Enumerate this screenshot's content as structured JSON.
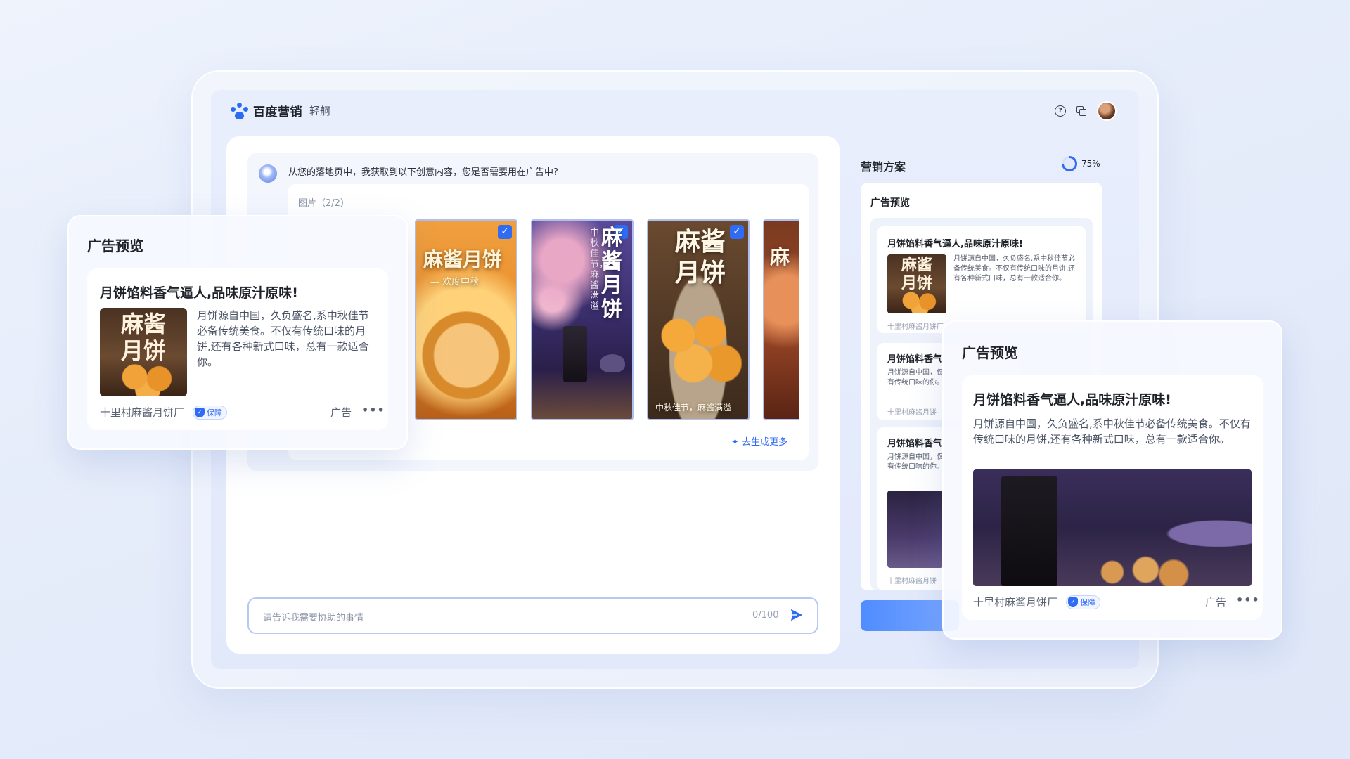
{
  "header": {
    "brand": "百度营销",
    "product": "轻舸",
    "help_icon": "help-circle-icon",
    "copy_icon": "copy-icon"
  },
  "chat": {
    "bot_message": "从您的落地页中，我获取到以下创意内容，您是否需要用在广告中?",
    "image_caption": "图片（2/2）",
    "posters": [
      {
        "title": "麻酱月饼",
        "subtitle": "— 欢度中秋",
        "checked": true
      },
      {
        "title": "麻酱月饼",
        "side": "中秋佳节，麻酱满溢",
        "checked": true
      },
      {
        "title": "麻酱月饼",
        "footer": "中秋佳节，麻酱满溢",
        "checked": true
      },
      {
        "title": "麻",
        "checked": false
      }
    ],
    "generate_more": "去生成更多",
    "input_placeholder": "请告诉我需要协助的事情",
    "counter": "0/100"
  },
  "right_panel": {
    "title": "营销方案",
    "progress": "75%",
    "progress_value": 0.75,
    "preview_title": "广告预览",
    "mini_ads": [
      {
        "title": "月饼馅料香气逼人,品味原汁原味!",
        "text": "月饼源自中国，久负盛名,系中秋佳节必备传统美食。不仅有传统口味的月饼,还有各种新式口味，总有一款适合你。",
        "source": "十里村麻酱月饼厂"
      },
      {
        "title": "月饼馅料香气",
        "text": "月饼源自中国，仅有传统口味的你。",
        "source": "十里村麻酱月饼"
      },
      {
        "title": "月饼馅料香气",
        "text": "月饼源自中国，仅有传统口味的你。",
        "source": "十里村麻酱月饼"
      }
    ]
  },
  "float_left": {
    "title": "广告预览",
    "ad_title": "月饼馅料香气逼人,品味原汁原味!",
    "thumb_text_1": "麻酱",
    "thumb_text_2": "月饼",
    "ad_text": "月饼源自中国，久负盛名,系中秋佳节必备传统美食。不仅有传统口味的月饼,还有各种新式口味，总有一款适合你。",
    "source": "十里村麻酱月饼厂",
    "badge": "保障",
    "tag": "广告",
    "more": "•••"
  },
  "float_right": {
    "title": "广告预览",
    "ad_title": "月饼馅料香气逼人,品味原汁原味!",
    "ad_text": "月饼源自中国，久负盛名,系中秋佳节必备传统美食。不仅有传统口味的月饼,还有各种新式口味，总有一款适合你。",
    "source": "十里村麻酱月饼厂",
    "badge": "保障",
    "tag": "广告",
    "more": "•••"
  },
  "colors": {
    "accent": "#2f6bf3",
    "background": "#e5ecfa"
  }
}
